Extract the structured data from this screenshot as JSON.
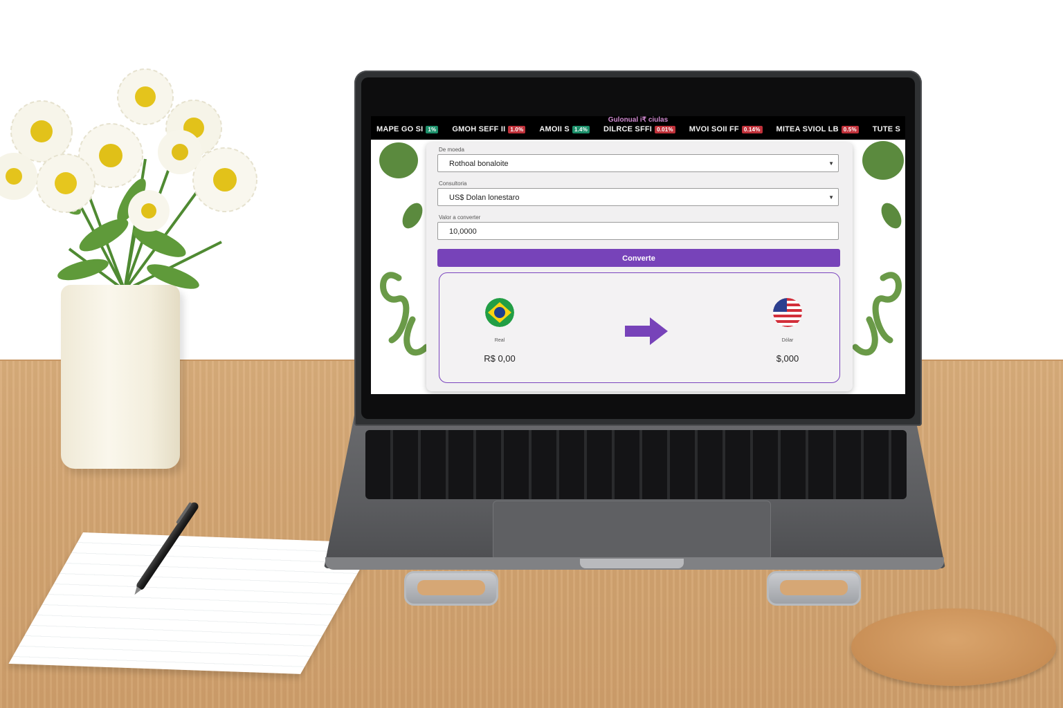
{
  "ticker": {
    "brand": "Gulonual i₹ ciulas",
    "items": [
      {
        "symbol": "MAPE GO SI",
        "change": "1%",
        "direction": "up"
      },
      {
        "symbol": "GMOH SEFF II",
        "change": "1.0%",
        "direction": "down"
      },
      {
        "symbol": "AMOII S",
        "change": "1.4%",
        "direction": "up"
      },
      {
        "symbol": "DILRCE SFFI",
        "change": "0.01%",
        "direction": "down"
      },
      {
        "symbol": "MVOI SOII FF",
        "change": "0.14%",
        "direction": "down"
      },
      {
        "symbol": "MITEA SVIOL LB",
        "change": "0.5%",
        "direction": "down"
      },
      {
        "symbol": "TUTE S",
        "change": "",
        "direction": "up"
      }
    ]
  },
  "converter": {
    "from_label": "De moeda",
    "from_value": "Rothoal bonaloite",
    "to_label": "Consultoria",
    "to_value": "US$ Dolan lonestaro",
    "amount_label": "Valor a converter",
    "amount_value": "10,0000",
    "convert_label": "Converte"
  },
  "result": {
    "from_currency_label": "Real",
    "from_amount": "R$ 0,00",
    "to_currency_label": "Dólar",
    "to_amount": "$,000"
  },
  "colors": {
    "accent": "#7743b9",
    "ticker_up": "#1c8f6a",
    "ticker_down": "#c0313a"
  },
  "icons": {
    "from_flag": "brazil-flag-icon",
    "to_flag": "usa-flag-icon",
    "arrow": "arrow-right-icon",
    "dropdown": "chevron-down-icon"
  }
}
